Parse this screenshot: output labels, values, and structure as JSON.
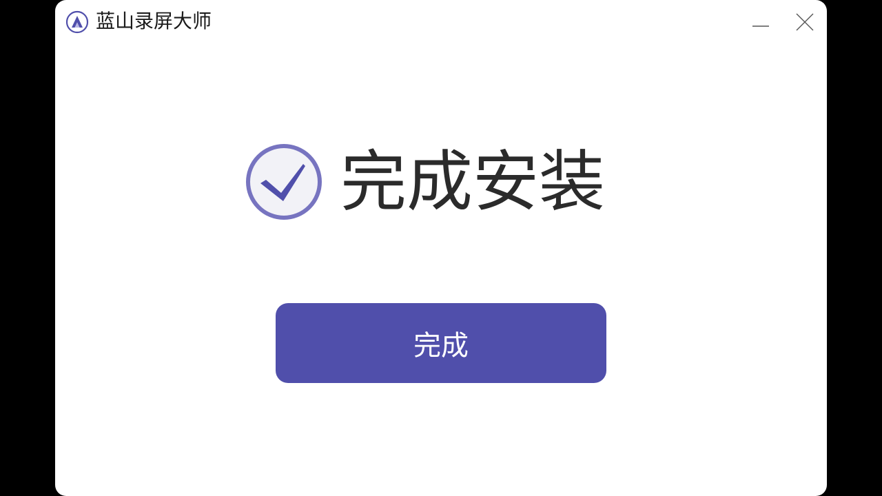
{
  "window": {
    "title": "蓝山录屏大师",
    "logo_icon": "app-logo-icon",
    "minimize_icon": "minimize-icon",
    "close_icon": "close-icon"
  },
  "main": {
    "status_icon": "check-circle-icon",
    "status_title": "完成安装",
    "finish_button_label": "完成"
  },
  "colors": {
    "accent": "#504fab",
    "check_ring": "#7774c0",
    "check_fill": "#f2f2f7",
    "background": "#ffffff",
    "outside": "#000000"
  }
}
